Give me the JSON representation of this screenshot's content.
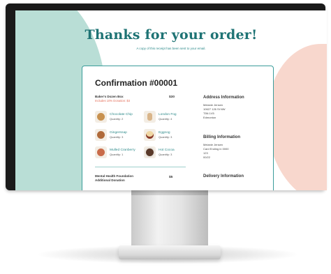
{
  "page": {
    "title": "Thanks for your order!",
    "subtitle": "A copy of this receipt has been sent to your email."
  },
  "order": {
    "confirmation": "Confirmation #00001",
    "box_name": "Baker's Dozen Box",
    "box_note": "Includes 10% Donation: $3",
    "box_price": "$30",
    "items": [
      {
        "name": "Chocolate Chip",
        "qty": "Quantity: 2",
        "color": "#c8914f"
      },
      {
        "name": "London Fog",
        "qty": "Quantity: 4",
        "color": "#d9b58a"
      },
      {
        "name": "Gingersnap",
        "qty": "Quantity: 3",
        "color": "#b06a3a"
      },
      {
        "name": "Eggnog",
        "qty": "Quantity: 3",
        "color": "#f0d7a3"
      },
      {
        "name": "Mulled Cranberry",
        "qty": "Quantity: 1",
        "color": "#c96b4a"
      },
      {
        "name": "Hot Cocoa",
        "qty": "Quantity: 3",
        "color": "#5a3a2a"
      }
    ],
    "donation_line1": "Mental Health Foundation",
    "donation_line2": "Additional Donation",
    "donation_price": "$5"
  },
  "address": {
    "heading": "Address Information",
    "lines": [
      "Melanie Jensen",
      "10627 126 St NW",
      "T5N 1V5",
      "Edmonton"
    ]
  },
  "billing": {
    "heading": "Billing Information",
    "lines": [
      "Melanie Jensen",
      "Card Ending in 0000",
      "123",
      "00/22"
    ]
  },
  "delivery": {
    "heading": "Delivery Information"
  },
  "colors": {
    "accent_teal": "#1e7374",
    "teal_blob": "#b9ded6",
    "pink_blob": "#f8d7cd",
    "note_red": "#e46f5b"
  }
}
